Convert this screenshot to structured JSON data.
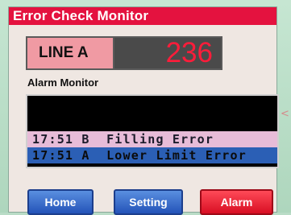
{
  "window": {
    "title": "Error Check Monitor"
  },
  "line": {
    "label": "LINE A",
    "count": "236"
  },
  "alarm_monitor": {
    "title": "Alarm Monitor",
    "rows": [
      {
        "text": ""
      },
      {
        "text": ""
      },
      {
        "text": "17:51 B  Filling Error"
      },
      {
        "text": "17:51 A  Lower Limit Error"
      }
    ]
  },
  "buttons": {
    "home": "Home",
    "setting": "Setting",
    "alarm": "Alarm"
  },
  "side_marker": "<",
  "colors": {
    "title_bar": "#e4123f",
    "counter_text": "#ff1c3a",
    "line_label_bg": "#f09aa3",
    "selected_row": "#e7bcd8",
    "active_row": "#2b5fb5",
    "nav_button": "#2353b8",
    "alarm_button": "#d80f23"
  }
}
